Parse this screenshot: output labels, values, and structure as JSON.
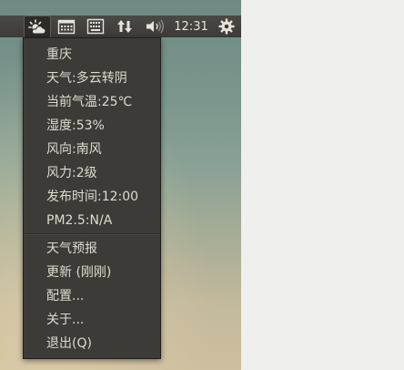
{
  "panel": {
    "clock": "12:31"
  },
  "menu": {
    "info_items": [
      "重庆",
      "天气:多云转阴",
      "当前气温:25℃",
      "湿度:53%",
      "风向:南风",
      "风力:2级",
      "发布时间:12:00",
      "PM2.5:N/A"
    ],
    "action_items": [
      "天气预报",
      "更新 (刚刚)",
      "配置...",
      "关于...",
      "退出(Q)"
    ]
  }
}
